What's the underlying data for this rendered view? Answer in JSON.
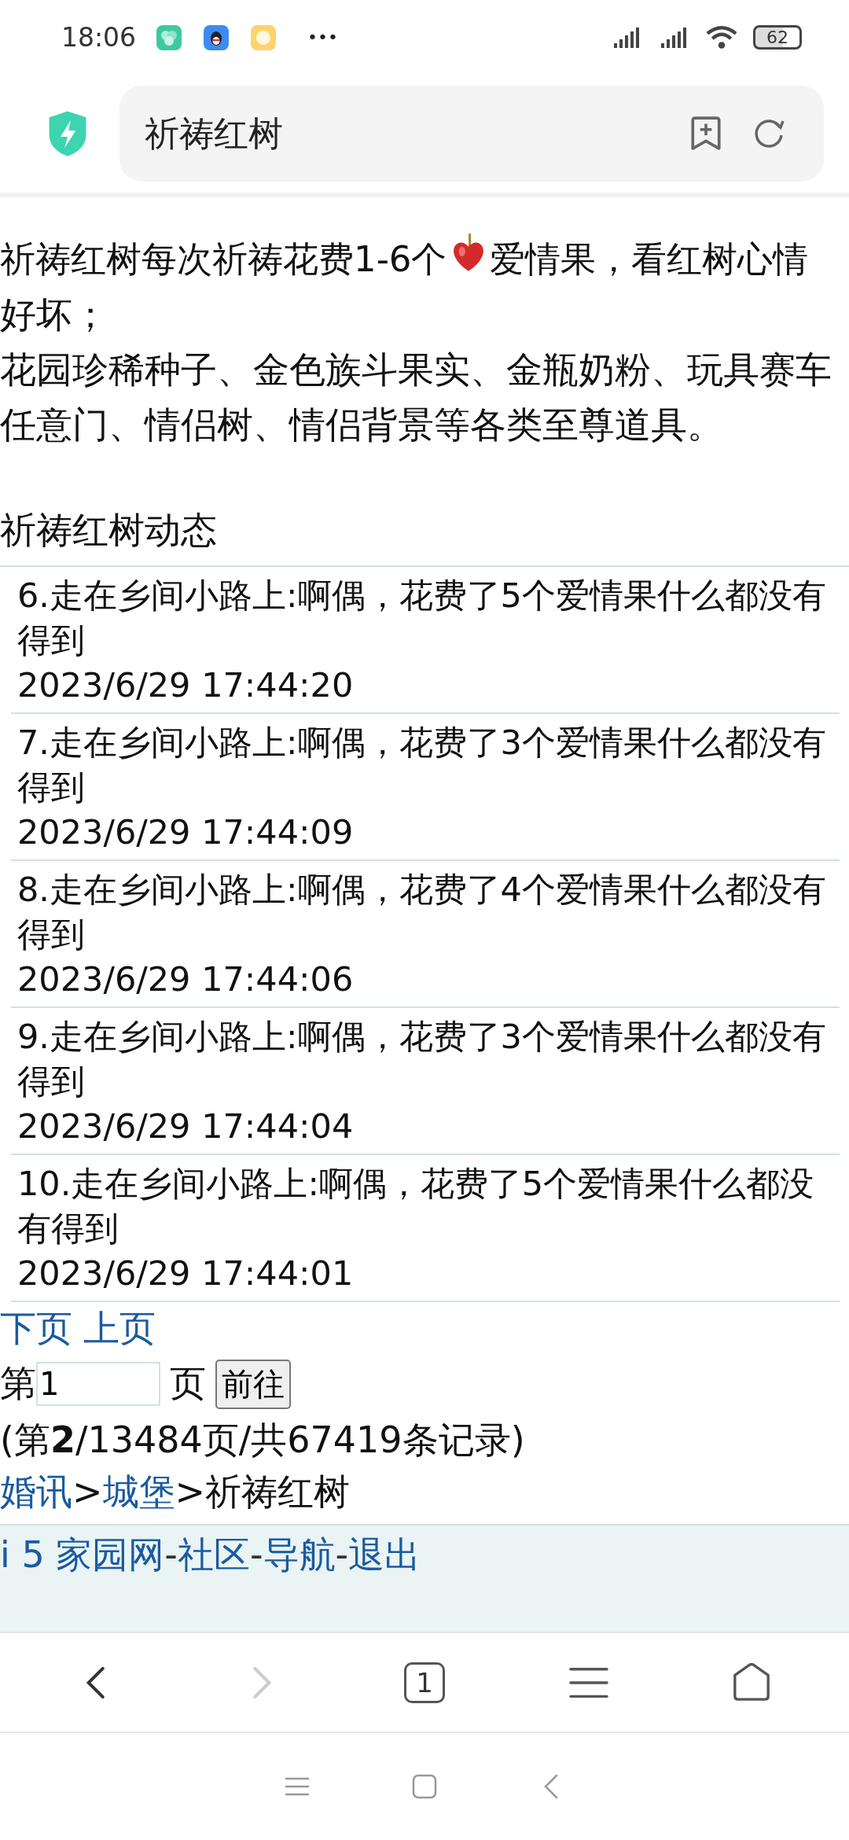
{
  "status_bar": {
    "time": "18:06",
    "more": "•••",
    "battery": "62"
  },
  "address_bar": {
    "title": "祈祷红树"
  },
  "intro": {
    "before_icon": "祈祷红树每次祈祷花费1-6个",
    "after_icon": "爱情果，看红树心情",
    "continuation": "好坏；",
    "items_text": "花园珍稀种子、金色族斗果实、金瓶奶粉、玩具赛车任意门、情侣树、情侣背景等各类至尊道具。"
  },
  "section_title": "祈祷红树动态",
  "records": [
    {
      "text": "6.走在乡间小路上:啊偶，花费了5个爱情果什么都没有得到",
      "time": "2023/6/29 17:44:20"
    },
    {
      "text": "7.走在乡间小路上:啊偶，花费了3个爱情果什么都没有得到",
      "time": "2023/6/29 17:44:09"
    },
    {
      "text": "8.走在乡间小路上:啊偶，花费了4个爱情果什么都没有得到",
      "time": "2023/6/29 17:44:06"
    },
    {
      "text": "9.走在乡间小路上:啊偶，花费了3个爱情果什么都没有得到",
      "time": "2023/6/29 17:44:04"
    },
    {
      "text": "10.走在乡间小路上:啊偶，花费了5个爱情果什么都没有得到",
      "time": "2023/6/29 17:44:01"
    }
  ],
  "pager": {
    "links": [
      "下页",
      "上页"
    ],
    "prefix": "第",
    "page_value": "1",
    "suffix": "页",
    "go_button": "前往",
    "summary": "(第**2**/13484页/共67419条记录)"
  },
  "breadcrumb": {
    "separator": ">",
    "items": [
      {
        "label": "婚讯",
        "link": true
      },
      {
        "label": "城堡",
        "link": true
      },
      {
        "label": "祈祷红树",
        "link": false
      }
    ]
  },
  "footer": {
    "separator": "-",
    "links": [
      "i 5 家园网",
      "社区",
      "导航",
      "退出"
    ]
  },
  "toolbar": {
    "tab_count": "1",
    "forward_disabled": true
  }
}
